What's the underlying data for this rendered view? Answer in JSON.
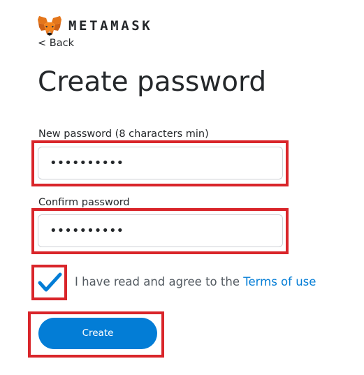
{
  "brand": {
    "name": "METAMASK",
    "icon": "metamask-fox-icon"
  },
  "nav": {
    "back_label": "< Back"
  },
  "page": {
    "title": "Create password"
  },
  "form": {
    "new_password": {
      "label": "New password (8 characters min)",
      "value": "••••••••••"
    },
    "confirm_password": {
      "label": "Confirm password",
      "value": "••••••••••"
    },
    "terms": {
      "checked": true,
      "text": "I have read and agree to the ",
      "link_label": "Terms of use"
    },
    "submit_label": "Create"
  },
  "colors": {
    "accent": "#037dd6",
    "highlight": "#d9252a",
    "text": "#24272a"
  }
}
